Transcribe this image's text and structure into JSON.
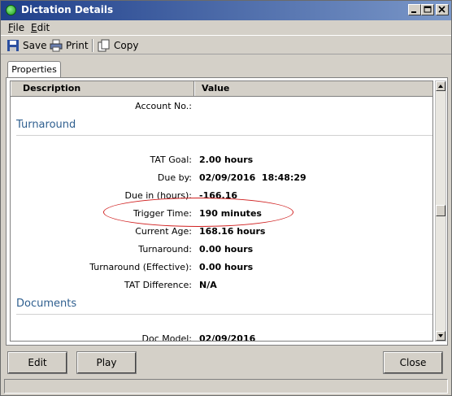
{
  "window": {
    "title": "Dictation Details"
  },
  "menu": {
    "file": {
      "mnemonic": "F",
      "rest": "ile"
    },
    "edit": {
      "mnemonic": "E",
      "rest": "dit"
    }
  },
  "toolbar": {
    "save": "Save",
    "print": "Print",
    "copy": "Copy"
  },
  "tabs": {
    "properties": "Properties"
  },
  "grid": {
    "columns": {
      "description": "Description",
      "value": "Value"
    },
    "account_label": "Account No.:",
    "account_value": "",
    "sections": {
      "turnaround": "Turnaround",
      "documents": "Documents"
    },
    "rows": [
      {
        "label": "TAT Goal:",
        "value": "2.00 hours"
      },
      {
        "label": "Due by:",
        "value": "02/09/2016  18:48:29"
      },
      {
        "label": "Due in (hours):",
        "value": "-166.16"
      },
      {
        "label": "Trigger Time:",
        "value": "190 minutes"
      },
      {
        "label": "Current Age:",
        "value": "168.16 hours"
      },
      {
        "label": "Turnaround:",
        "value": "0.00 hours"
      },
      {
        "label": "Turnaround (Effective):",
        "value": "0.00 hours"
      },
      {
        "label": "TAT Difference:",
        "value": "N/A"
      }
    ],
    "doc_model_label": "Doc Model:",
    "doc_model_value": "02/09/2016"
  },
  "buttons": {
    "edit": "Edit",
    "play": "Play",
    "close": "Close"
  },
  "colors": {
    "title_start": "#1f3f8a",
    "title_end": "#7a97c8",
    "section": "#2f5f8f",
    "highlight": "#d02020"
  },
  "icons": [
    "app-status-icon",
    "minimize-icon",
    "maximize-icon",
    "close-icon",
    "save-icon",
    "print-icon",
    "copy-icon",
    "scroll-up-icon",
    "scroll-down-icon"
  ]
}
